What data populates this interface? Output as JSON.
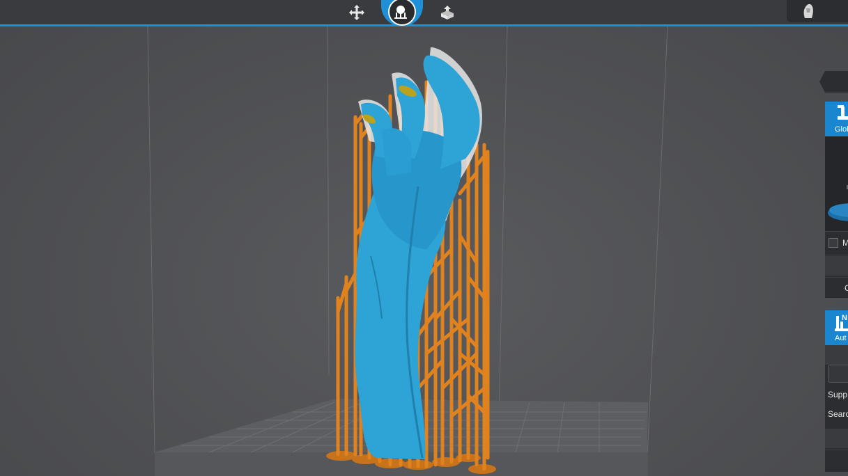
{
  "topbar": {
    "stages": [
      {
        "name": "prepare",
        "icon": "move-arrows-icon"
      },
      {
        "name": "supports",
        "icon": "supports-icon",
        "active": true
      },
      {
        "name": "export",
        "icon": "export-icon"
      }
    ],
    "accent_color": "#1e90d8"
  },
  "right_panel": {
    "global_header_label": "Glob",
    "checkbox_label": "M",
    "row_label": "C",
    "auto_header_label": "Aut",
    "auto_header_icon_text": "N",
    "support_label": "Supp",
    "search_label": "Searc"
  },
  "scene": {
    "model_color": "#2ea3d6",
    "support_color": "#e0831f"
  }
}
